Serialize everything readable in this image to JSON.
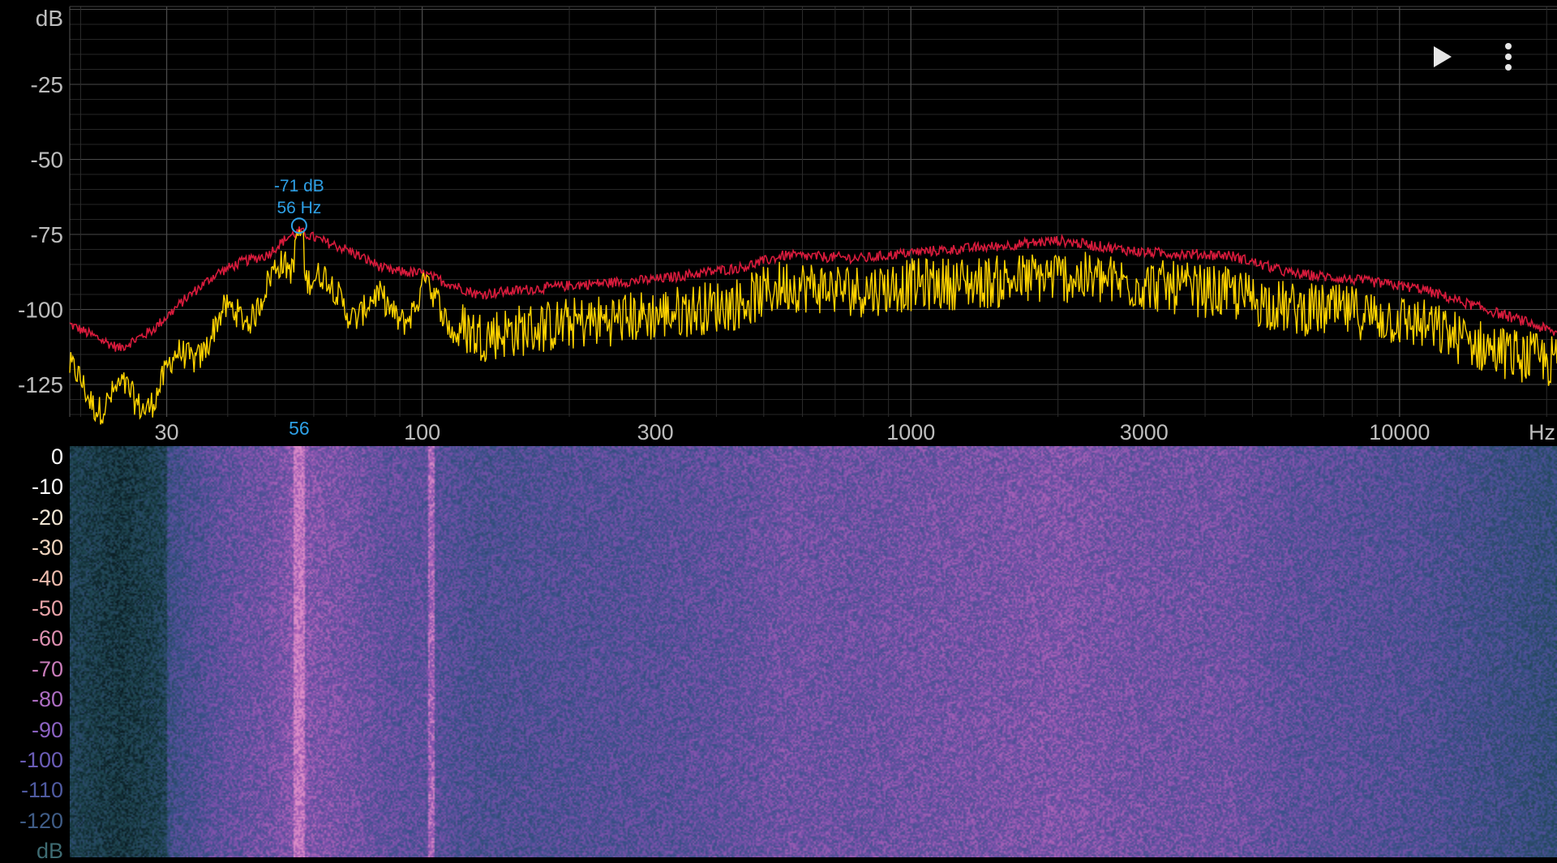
{
  "spectrum": {
    "y_unit": "dB",
    "x_unit": "Hz",
    "y_ticks": [
      "-25",
      "-50",
      "-75",
      "-100",
      "-125"
    ],
    "x_ticks": [
      "30",
      "100",
      "300",
      "1000",
      "3000",
      "10000"
    ],
    "marker": {
      "db_label": "-71 dB",
      "hz_label": "56 Hz",
      "axis_label": "56",
      "freq_hz": 56,
      "level_db": -71
    },
    "colors": {
      "background": "#000000",
      "grid": "#3a3a3a",
      "peak_hold_trace": "#d81b3c",
      "live_trace": "#ffd400",
      "marker": "#2ea0e6",
      "axis_text": "#bdbdbd"
    }
  },
  "spectrogram": {
    "scale_labels": [
      "0",
      "-10",
      "-20",
      "-30",
      "-40",
      "-50",
      "-60",
      "-70",
      "-80",
      "-90",
      "-100",
      "-110",
      "-120",
      "dB"
    ],
    "label_colors": [
      "#ffffff",
      "#ffffff",
      "#f3e7d4",
      "#f0d4be",
      "#eebcae",
      "#e8a3a8",
      "#dc8fb0",
      "#c97cba",
      "#ad6dc2",
      "#8b62c2",
      "#6a5cb6",
      "#4f5aa0",
      "#3f5c86",
      "#3e6b72"
    ]
  },
  "toolbar": {
    "play_icon": "play-icon",
    "menu_icon": "more-vert-icon"
  }
}
